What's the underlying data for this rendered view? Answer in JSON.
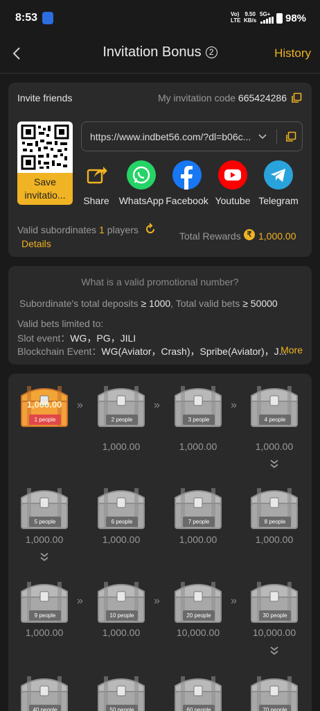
{
  "status": {
    "time": "8:53",
    "net": "Vo) LTE",
    "speed": "9.50 KB/s",
    "signal": "5G+",
    "battery": "98%"
  },
  "header": {
    "title": "Invitation Bonus",
    "help": "2",
    "history": "History"
  },
  "invite": {
    "label": "Invite friends",
    "code_label": "My invitation code",
    "code": "665424286",
    "save_label": "Save invitatio...",
    "url": "https://www.indbet56.com/?dl=b06c...",
    "share_items": [
      {
        "name": "Share",
        "icon": "share-icon",
        "color": "#f0b323"
      },
      {
        "name": "WhatsApp",
        "icon": "whatsapp-icon",
        "color": "#25d366"
      },
      {
        "name": "Facebook",
        "icon": "facebook-icon",
        "color": "#1877f2"
      },
      {
        "name": "Youtube",
        "icon": "youtube-icon",
        "color": "#ff0000"
      },
      {
        "name": "Telegram",
        "icon": "telegram-icon",
        "color": "#2aa3dc"
      }
    ],
    "valid_prefix": "Valid subordinates",
    "valid_count": "1",
    "valid_suffix": "players",
    "details": "Details",
    "total_label": "Total Rewards",
    "total_value": "1,000.00"
  },
  "rules": {
    "question": "What is a valid promotional number?",
    "cond_a": "Subordinate's total deposits",
    "cond_a_val": "≥ 1000",
    "cond_b": ", Total valid bets",
    "cond_b_val": "≥ 50000",
    "limited": "Valid bets limited to:",
    "slot_label": "Slot event：",
    "slot_val": "WG，PG，JILI",
    "block_label": "Blockchain Event：",
    "block_val": "WG(Aviator，Crash)，Spribe(Aviator)，J...",
    "more": "More"
  },
  "chests": [
    {
      "people": "1 people",
      "amount": "1,000.00",
      "active": true
    },
    {
      "people": "2 people",
      "amount": "1,000.00"
    },
    {
      "people": "3 people",
      "amount": "1,000.00"
    },
    {
      "people": "4 people",
      "amount": "1,000.00"
    },
    {
      "people": "8 people",
      "amount": "1,000.00"
    },
    {
      "people": "7 people",
      "amount": "1,000.00"
    },
    {
      "people": "6 people",
      "amount": "1,000.00"
    },
    {
      "people": "5 people",
      "amount": "1,000.00"
    },
    {
      "people": "9 people",
      "amount": "1,000.00"
    },
    {
      "people": "10 people",
      "amount": "1,000.00"
    },
    {
      "people": "20 people",
      "amount": "10,000.00"
    },
    {
      "people": "30 people",
      "amount": "10,000.00"
    },
    {
      "people": "70 people",
      "amount": ""
    },
    {
      "people": "60 people",
      "amount": ""
    },
    {
      "people": "50 people",
      "amount": ""
    },
    {
      "people": "40 people",
      "amount": ""
    }
  ],
  "colors": {
    "accent": "#f0b323",
    "bg": "#1a1a1a",
    "card": "#2a2a2a"
  }
}
